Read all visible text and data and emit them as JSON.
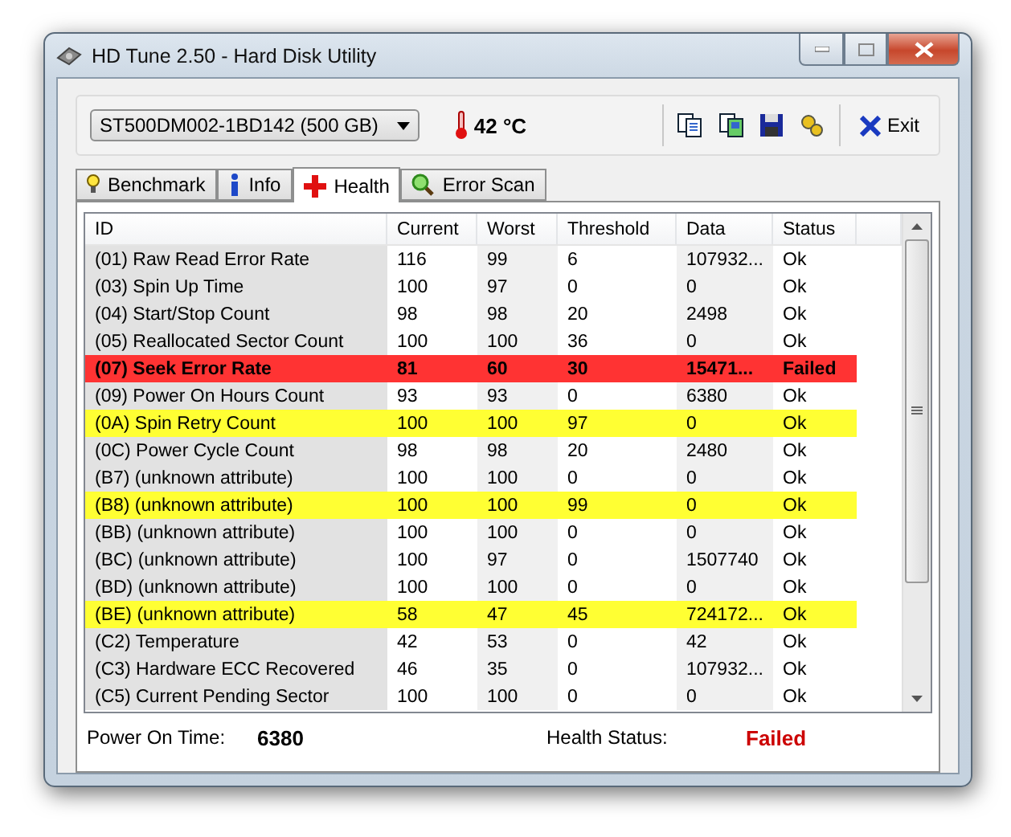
{
  "window": {
    "title": "HD Tune 2.50 - Hard Disk Utility"
  },
  "toolbar": {
    "drive": "ST500DM002-1BD142 (500 GB)",
    "temperature": "42 °C",
    "exit_label": "Exit"
  },
  "tabs": [
    {
      "label": "Benchmark",
      "selected": false,
      "kind": "bulb"
    },
    {
      "label": "Info",
      "selected": false,
      "kind": "info"
    },
    {
      "label": "Health",
      "selected": true,
      "kind": "cross"
    },
    {
      "label": "Error Scan",
      "selected": false,
      "kind": "magnifier"
    }
  ],
  "table": {
    "columns": [
      "ID",
      "Current",
      "Worst",
      "Threshold",
      "Data",
      "Status"
    ],
    "rows": [
      {
        "kind": "normal",
        "cells": [
          "(01) Raw Read Error Rate",
          "116",
          "99",
          "6",
          "107932...",
          "Ok"
        ]
      },
      {
        "kind": "normal",
        "cells": [
          "(03) Spin Up Time",
          "100",
          "97",
          "0",
          "0",
          "Ok"
        ]
      },
      {
        "kind": "normal",
        "cells": [
          "(04) Start/Stop Count",
          "98",
          "98",
          "20",
          "2498",
          "Ok"
        ]
      },
      {
        "kind": "normal",
        "cells": [
          "(05) Reallocated Sector Count",
          "100",
          "100",
          "36",
          "0",
          "Ok"
        ]
      },
      {
        "kind": "failed",
        "cells": [
          "(07) Seek Error Rate",
          "81",
          "60",
          "30",
          "15471...",
          "Failed"
        ]
      },
      {
        "kind": "normal",
        "cells": [
          "(09) Power On Hours Count",
          "93",
          "93",
          "0",
          "6380",
          "Ok"
        ]
      },
      {
        "kind": "warning",
        "cells": [
          "(0A) Spin Retry Count",
          "100",
          "100",
          "97",
          "0",
          "Ok"
        ]
      },
      {
        "kind": "normal",
        "cells": [
          "(0C) Power Cycle Count",
          "98",
          "98",
          "20",
          "2480",
          "Ok"
        ]
      },
      {
        "kind": "normal",
        "cells": [
          "(B7) (unknown attribute)",
          "100",
          "100",
          "0",
          "0",
          "Ok"
        ]
      },
      {
        "kind": "warning",
        "cells": [
          "(B8) (unknown attribute)",
          "100",
          "100",
          "99",
          "0",
          "Ok"
        ]
      },
      {
        "kind": "normal",
        "cells": [
          "(BB) (unknown attribute)",
          "100",
          "100",
          "0",
          "0",
          "Ok"
        ]
      },
      {
        "kind": "normal",
        "cells": [
          "(BC) (unknown attribute)",
          "100",
          "97",
          "0",
          "1507740",
          "Ok"
        ]
      },
      {
        "kind": "normal",
        "cells": [
          "(BD) (unknown attribute)",
          "100",
          "100",
          "0",
          "0",
          "Ok"
        ]
      },
      {
        "kind": "warning",
        "cells": [
          "(BE) (unknown attribute)",
          "58",
          "47",
          "45",
          "724172...",
          "Ok"
        ]
      },
      {
        "kind": "normal",
        "cells": [
          "(C2) Temperature",
          "42",
          "53",
          "0",
          "42",
          "Ok"
        ]
      },
      {
        "kind": "normal",
        "cells": [
          "(C3) Hardware ECC Recovered",
          "46",
          "35",
          "0",
          "107932...",
          "Ok"
        ]
      },
      {
        "kind": "normal",
        "cells": [
          "(C5) Current Pending Sector",
          "100",
          "100",
          "0",
          "0",
          "Ok"
        ]
      }
    ]
  },
  "footer": {
    "power_on_label": "Power On Time:",
    "power_on_value": "6380",
    "health_label": "Health Status:",
    "health_value": "Failed"
  }
}
